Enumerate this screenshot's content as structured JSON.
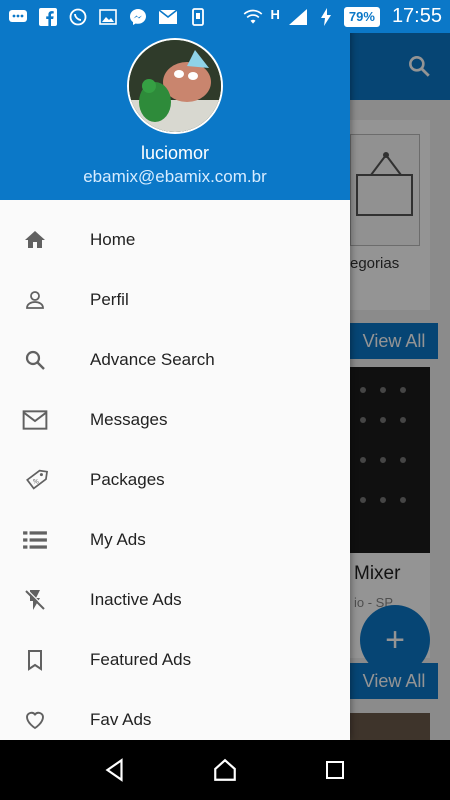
{
  "status_bar": {
    "battery": "79%",
    "network": "H",
    "time": "17:55"
  },
  "drawer": {
    "user_name": "luciomor",
    "user_email": "ebamix@ebamix.com.br",
    "menu": [
      {
        "label": "Home",
        "icon": "home-icon"
      },
      {
        "label": "Perfil",
        "icon": "person-icon"
      },
      {
        "label": "Advance Search",
        "icon": "search-icon"
      },
      {
        "label": "Messages",
        "icon": "mail-icon"
      },
      {
        "label": "Packages",
        "icon": "tag-icon"
      },
      {
        "label": "My Ads",
        "icon": "list-icon"
      },
      {
        "label": "Inactive Ads",
        "icon": "flash-off-icon"
      },
      {
        "label": "Featured Ads",
        "icon": "bookmark-icon"
      },
      {
        "label": "Fav Ads",
        "icon": "heart-icon"
      }
    ]
  },
  "background": {
    "category_label": "egorias",
    "view_all_1": "View All",
    "product_title": "Mixer",
    "product_location": "io - SP",
    "view_all_2": "View All",
    "fab_label": "+"
  },
  "colors": {
    "primary": "#0b78c8",
    "drawer_bg": "#fafafa",
    "icon": "#616161"
  }
}
